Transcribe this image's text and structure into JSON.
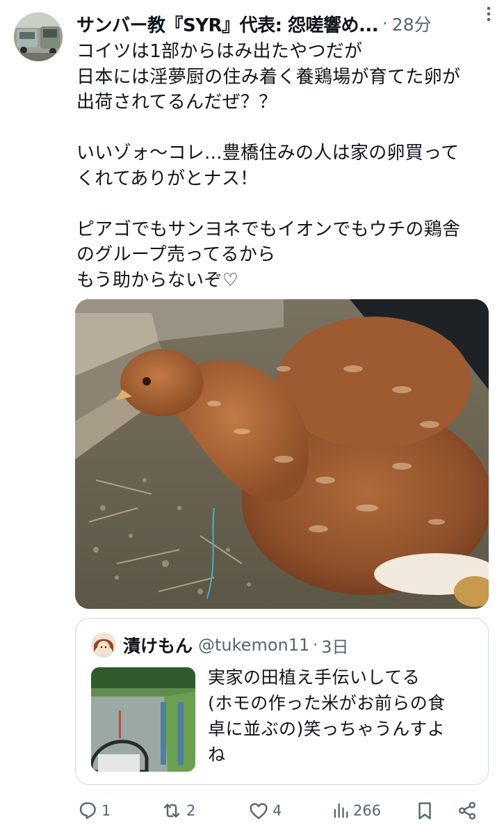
{
  "post": {
    "display_name": "サンバー教『SYR』代表: 怨嗟響め...",
    "separator": "·",
    "time_ago": "28分",
    "text_lines": [
      "コイツは1部からはみ出たやつだが",
      "日本には淫夢厨の住み着く養鶏場が育てた卵が",
      "出荷されてるんだぜ？？",
      "",
      "いいゾォ〜コレ...豊橋住みの人は家の卵買って",
      "くれてありがとナス！",
      "",
      "ピアゴでもサンヨネでもイオンでもウチの鶏舎",
      "のグループ売ってるから",
      "もう助からないぞ♡"
    ]
  },
  "quote": {
    "display_name": "漬けもん",
    "handle": "@tukemon11",
    "separator": "·",
    "time_ago": "3日",
    "text_lines": [
      "実家の田植え手伝いしてる",
      "(ホモの作った米がお前らの食",
      "卓に並ぶの)笑っちゃうんすよ",
      "ね"
    ]
  },
  "actions": {
    "replies": "1",
    "reposts": "2",
    "likes": "4",
    "views": "266"
  },
  "colors": {
    "text_primary": "#0f1419",
    "text_secondary": "#536471",
    "border": "#cfd9de"
  },
  "icons": {
    "more": "more-vertical-icon",
    "reply": "reply-icon",
    "repost": "repost-icon",
    "like": "heart-icon",
    "views": "views-icon",
    "bookmark": "bookmark-icon",
    "share": "share-icon"
  }
}
